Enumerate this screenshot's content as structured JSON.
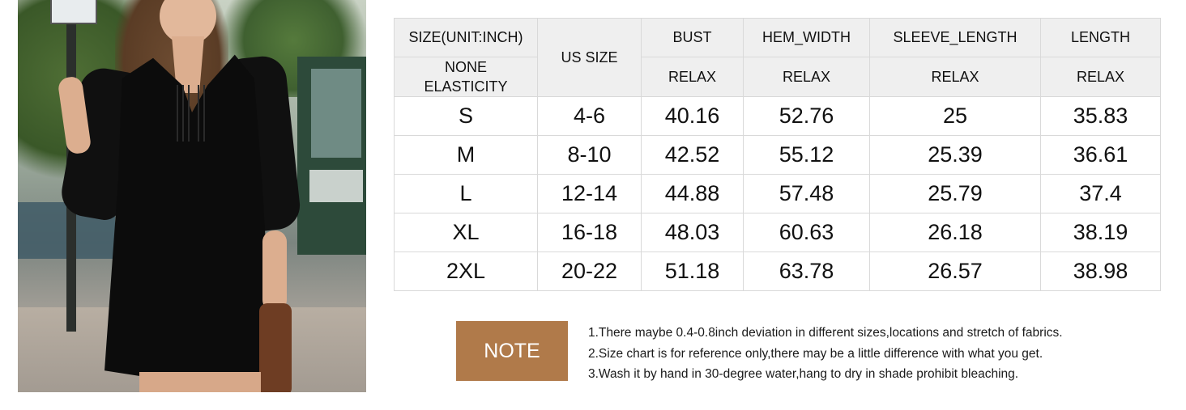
{
  "product": {
    "photo_description_icon": "model-photo-icon",
    "background_color": "#ffffff"
  },
  "size_chart": {
    "header_row1": {
      "size_unit": "SIZE(UNIT:INCH)",
      "us_size": "US SIZE",
      "bust": "BUST",
      "hem_width": "HEM_WIDTH",
      "sleeve_length": "SLEEVE_LENGTH",
      "length": "LENGTH"
    },
    "header_row2": {
      "elasticity": "NONE\nELASTICITY",
      "bust": "RELAX",
      "hem_width": "RELAX",
      "sleeve_length": "RELAX",
      "length": "RELAX"
    },
    "rows": [
      {
        "size": "S",
        "us": "4-6",
        "bust": "40.16",
        "hem": "52.76",
        "sleeve": "25",
        "length": "35.83"
      },
      {
        "size": "M",
        "us": "8-10",
        "bust": "42.52",
        "hem": "55.12",
        "sleeve": "25.39",
        "length": "36.61"
      },
      {
        "size": "L",
        "us": "12-14",
        "bust": "44.88",
        "hem": "57.48",
        "sleeve": "25.79",
        "length": "37.4"
      },
      {
        "size": "XL",
        "us": "16-18",
        "bust": "48.03",
        "hem": "60.63",
        "sleeve": "26.18",
        "length": "38.19"
      },
      {
        "size": "2XL",
        "us": "20-22",
        "bust": "51.18",
        "hem": "63.78",
        "sleeve": "26.57",
        "length": "38.98"
      }
    ],
    "colors": {
      "header_bg": "#efefef",
      "border": "#d9d9d9"
    }
  },
  "note": {
    "label": "NOTE",
    "color": "#b07a4a",
    "lines": [
      "1.There maybe 0.4-0.8inch deviation in different sizes,locations and stretch of fabrics.",
      "2.Size chart is for reference only,there may be a little difference with what you get.",
      "3.Wash it by hand in 30-degree water,hang to dry in shade prohibit bleaching."
    ]
  }
}
